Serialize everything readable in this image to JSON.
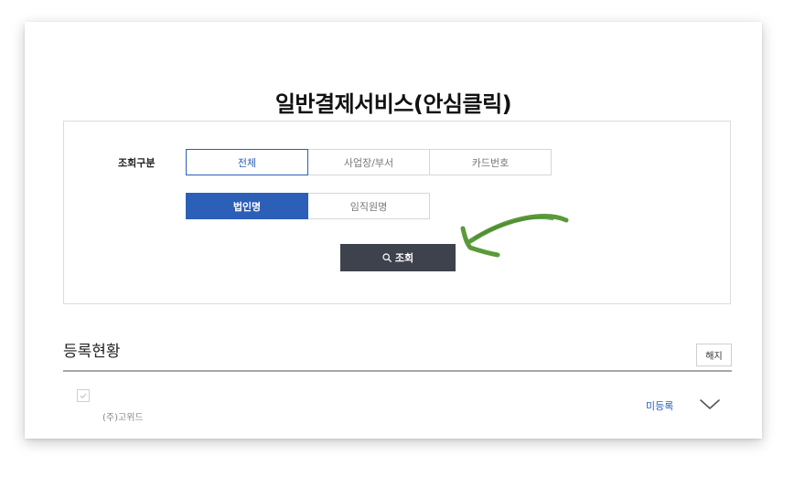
{
  "page": {
    "title": "일반결제서비스(안심클릭)"
  },
  "search": {
    "label": "조회구분",
    "type_options": [
      "전체",
      "사업장/부서",
      "카드번호"
    ],
    "name_options": [
      "법인명",
      "임직원명"
    ],
    "submit_label": "조회",
    "submit_icon": "search-icon"
  },
  "registration": {
    "title": "등록현황",
    "cancel_label": "해지",
    "rows": [
      {
        "name": "(주)고위드",
        "status": "미등록",
        "toggle_icon": "chevron-down-icon"
      }
    ]
  },
  "colors": {
    "primary": "#2b5fb8",
    "dark_button": "#3d424d",
    "arrow": "#5a9a3a"
  }
}
